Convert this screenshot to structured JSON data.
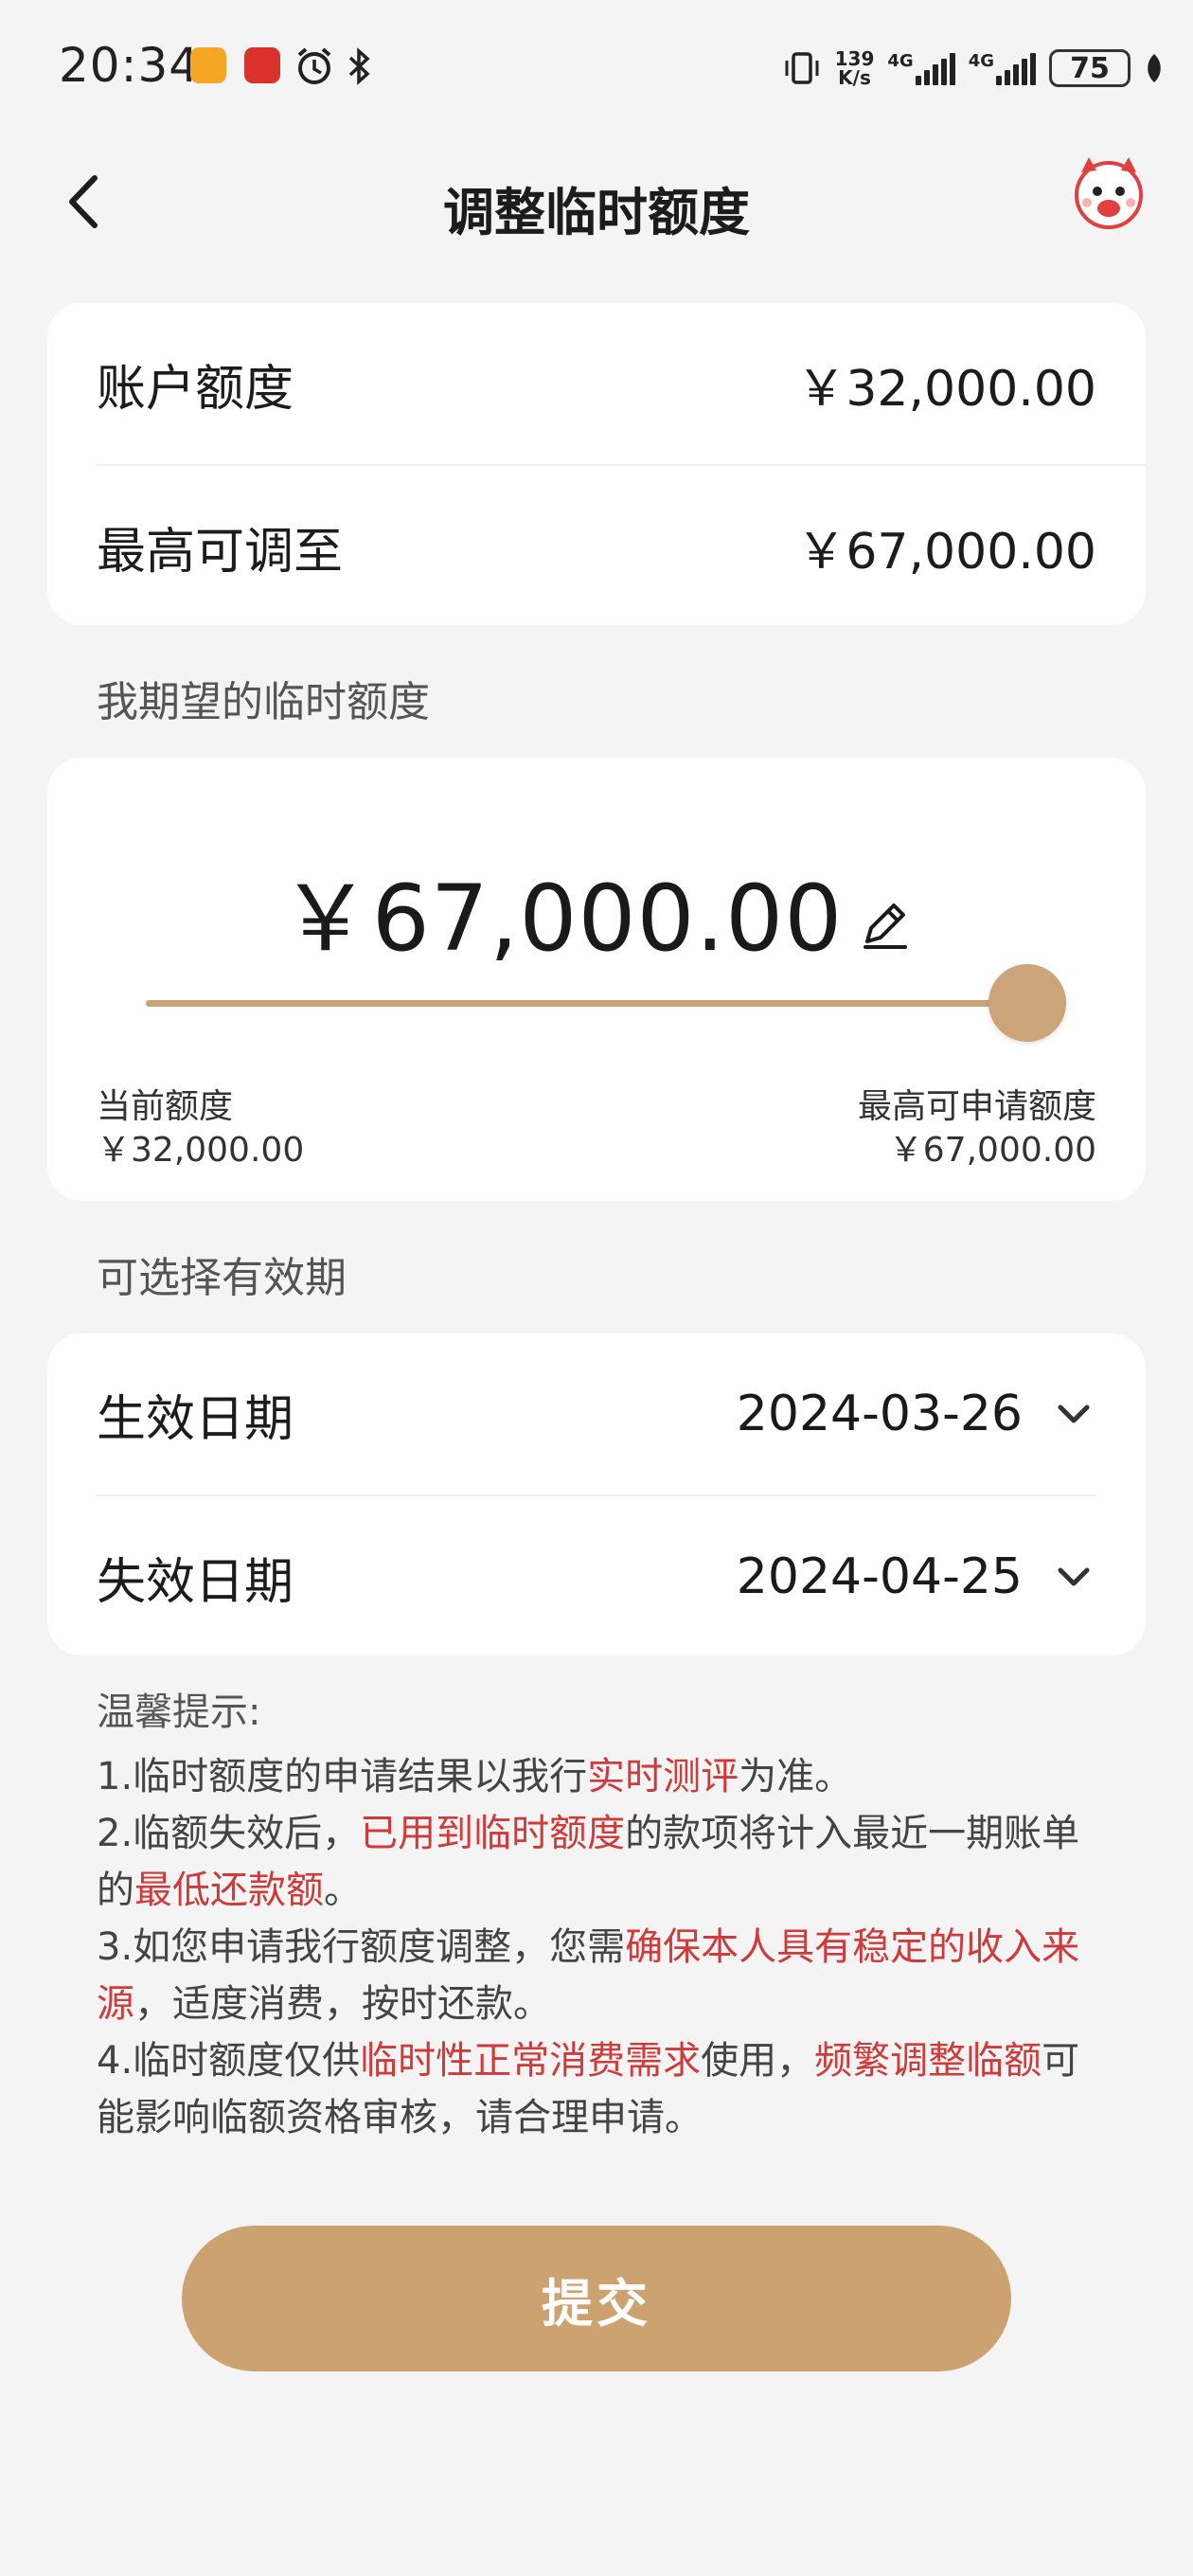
{
  "status_bar": {
    "time": "20:34",
    "net_speed_value": "139",
    "net_speed_unit": "K/s",
    "network_type_1": "4G",
    "network_type_2": "4G",
    "battery": "75"
  },
  "header": {
    "title": "调整临时额度",
    "back_icon": "chevron-left-icon",
    "mascot_icon": "mascot-icon"
  },
  "account": {
    "credit_limit_label": "账户额度",
    "credit_limit_value": "￥32,000.00",
    "max_adjust_label": "最高可调至",
    "max_adjust_value": "￥67,000.00"
  },
  "expected": {
    "section_label": "我期望的临时额度",
    "amount": "￥67,000.00",
    "slider_level": 1.0,
    "current_label": "当前额度",
    "current_value": "￥32,000.00",
    "max_label": "最高可申请额度",
    "max_value": "￥67,000.00"
  },
  "validity": {
    "section_label": "可选择有效期",
    "start_label": "生效日期",
    "start_value": "2024-03-26",
    "end_label": "失效日期",
    "end_value": "2024-04-25"
  },
  "tips": {
    "title": "温馨提示:",
    "t1_a": "1.临时额度的申请结果以我行",
    "t1_b": "实时测评",
    "t1_c": "为准。",
    "t2_a": "2.临额失效后，",
    "t2_b": "已用到临时额度",
    "t2_c": "的款项将计入最近一期账单的",
    "t2_d": "最低还款额",
    "t2_e": "。",
    "t3_a": "3.如您申请我行额度调整，您需",
    "t3_b": "确保本人具有稳定的收入来源",
    "t3_c": "，适度消费，按时还款。",
    "t4_a": "4.临时额度仅供",
    "t4_b": "临时性正常消费需求",
    "t4_c": "使用，",
    "t4_d": "频繁调整临额",
    "t4_e": "可能影响临额资格审核，请合理申请。"
  },
  "submit_label": "提交",
  "colors": {
    "accent": "#cda271",
    "highlight": "#cf3a3a",
    "background": "#f4f4f4"
  }
}
